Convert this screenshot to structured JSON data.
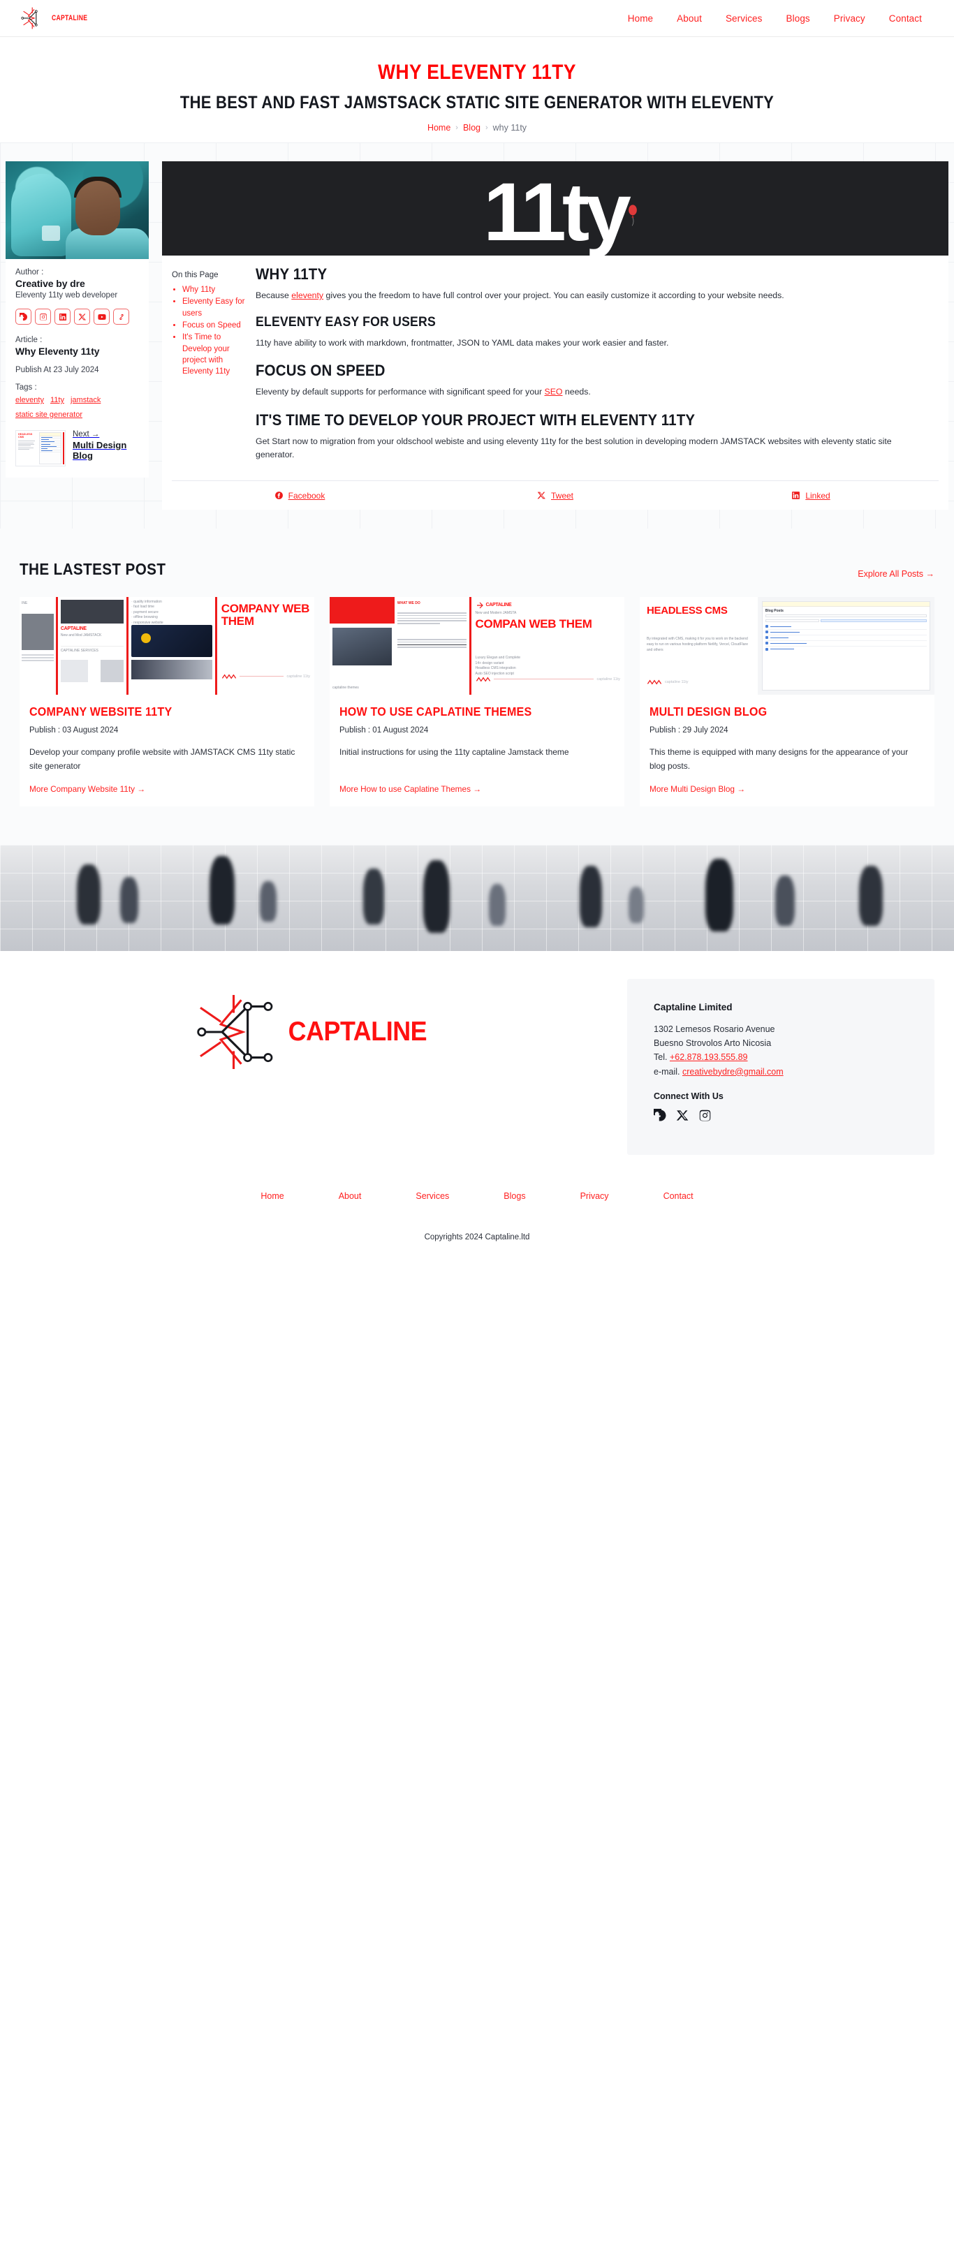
{
  "header": {
    "brand_name": "CAPTALINE",
    "nav": [
      {
        "label": "Home"
      },
      {
        "label": "About"
      },
      {
        "label": "Services"
      },
      {
        "label": "Blogs"
      },
      {
        "label": "Privacy"
      },
      {
        "label": "Contact"
      }
    ]
  },
  "hero": {
    "title": "WHY ELEVENTY 11TY",
    "subtitle": "THE BEST AND FAST JAMSTSACK STATIC SITE GENERATOR WITH ELEVENTY",
    "breadcrumb": {
      "home": "Home",
      "blog": "Blog",
      "current": "why 11ty",
      "separator": "›"
    }
  },
  "author_card": {
    "author_label": "Author :",
    "author_name": "Creative by dre",
    "author_role": "Eleventy 11ty web developer",
    "socials": [
      {
        "name": "facebook-icon"
      },
      {
        "name": "instagram-icon"
      },
      {
        "name": "linkedin-icon"
      },
      {
        "name": "x-twitter-icon"
      },
      {
        "name": "youtube-icon"
      },
      {
        "name": "link-icon"
      }
    ],
    "article_label": "Article :",
    "article_title": "Why Eleventy 11ty",
    "publish": "Publish At 23 July 2024",
    "tags_label": "Tags :",
    "tags": [
      "eleventy",
      "11ty",
      "jamstack",
      "static site generator"
    ],
    "next_label": "Next →",
    "next_title": "Multi Design Blog",
    "next_thumb_title": "HEADLESS CMS"
  },
  "article": {
    "hero_text": "11ty",
    "toc_title": "On this Page",
    "toc": [
      {
        "label": "Why 11ty"
      },
      {
        "label": "Eleventy Easy for users"
      },
      {
        "label": "Focus on Speed"
      },
      {
        "label": "It's Time to Develop your project with Eleventy 11ty"
      }
    ],
    "sections": [
      {
        "heading": "WHY 11TY",
        "body_1": "Because ",
        "link": "eleventy",
        "body_2": " gives you the freedom to have full control over your project. You can easily customize it according to your website needs."
      },
      {
        "heading": "ELEVENTY EASY FOR USERS",
        "body_1": "11ty have ability to work with markdown, frontmatter, JSON to YAML data makes your work easier and faster.",
        "link": "",
        "body_2": ""
      },
      {
        "heading": "FOCUS ON SPEED",
        "body_1": "Eleventy by default supports for performance with significant speed for your ",
        "link": "SEO",
        "body_2": " needs."
      },
      {
        "heading": "IT'S TIME TO DEVELOP YOUR PROJECT WITH ELEVENTY 11TY",
        "body_1": "Get Start now to migration from your oldschool webiste and using eleventy 11ty for the best solution in developing modern JAMSTACK websites with eleventy static site generator.",
        "link": "",
        "body_2": ""
      }
    ],
    "share": [
      {
        "label": "Facebook",
        "icon": "facebook-icon"
      },
      {
        "label": "Tweet",
        "icon": "x-twitter-icon"
      },
      {
        "label": "Linked",
        "icon": "linkedin-icon"
      }
    ]
  },
  "latest": {
    "title": "THE LASTEST POST",
    "explore": "Explore All Posts →",
    "posts": [
      {
        "title": "COMPANY WEBSITE 11TY",
        "date": "Publish : 03 August 2024",
        "desc": "Develop your company profile website with JAMSTACK CMS 11ty static site generator",
        "more": "More Company Website 11ty →",
        "thumb_heading": "COMPANY WEB THEM",
        "thumb_brand": "CAPTALINE",
        "thumb_sub": "New and Mod JAMSTACK",
        "thumb_caption": "captaline 11ty"
      },
      {
        "title": "HOW TO USE CAPLATINE THEMES",
        "date": "Publish : 01 August 2024",
        "desc": "Initial instructions for using the 11ty captaline Jamstack theme",
        "more": "More How to use Caplatine Themes →",
        "thumb_heading": "COMPAN WEB THEM",
        "thumb_brand": "CAPTALINE",
        "thumb_sub": "New and Modern JAMSTA",
        "thumb_caption": "captaline 11ty"
      },
      {
        "title": "MULTI DESIGN BLOG",
        "date": "Publish : 29 July 2024",
        "desc": "This theme is equipped with many designs for the appearance of your blog posts.",
        "more": "More Multi Design Blog →",
        "thumb_heading": "HEADLESS CMS",
        "thumb_brand": "",
        "thumb_sub": "Blog Posts",
        "thumb_caption": "captaline 11ty"
      }
    ]
  },
  "footer": {
    "brand_word": "CAPTALINE",
    "company": "Captaline Limited",
    "address_1": "1302 Lemesos Rosario Avenue",
    "address_2": "Buesno Strovolos Arto Nicosia",
    "tel_label": "Tel. ",
    "tel": "+62.878.193.555.89",
    "email_label": "e-mail. ",
    "email": "creativebydre@gmail.com",
    "connect": "Connect With Us",
    "socials": [
      {
        "name": "facebook-icon"
      },
      {
        "name": "x-twitter-icon"
      },
      {
        "name": "instagram-icon"
      }
    ],
    "nav": [
      {
        "label": "Home"
      },
      {
        "label": "About"
      },
      {
        "label": "Services"
      },
      {
        "label": "Blogs"
      },
      {
        "label": "Privacy"
      },
      {
        "label": "Contact"
      }
    ],
    "copyright": "Copyrights 2024 Captaline.ltd"
  },
  "colors": {
    "accent": "#ff1111",
    "link": "#ff2020",
    "text": "#1f2430",
    "panel": "#f6f7f9"
  }
}
